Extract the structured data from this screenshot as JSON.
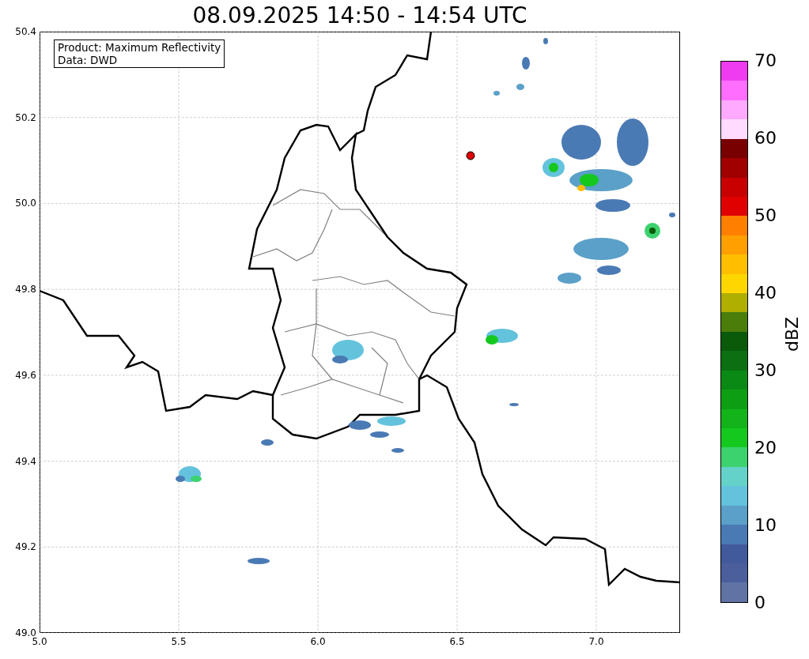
{
  "title": "08.09.2025 14:50 - 14:54 UTC",
  "legend": {
    "lines": [
      "Product: Maximum Reflectivity",
      "Data: DWD"
    ]
  },
  "map": {
    "x_ticks": [
      "5.0",
      "5.5",
      "6.0",
      "6.5",
      "7.0"
    ],
    "y_ticks": [
      "50.4",
      "50.2",
      "50.0",
      "49.8",
      "49.6",
      "49.4",
      "49.2",
      "49.0"
    ]
  },
  "colorbar": {
    "label": "dBZ",
    "ticks": [
      "70",
      "60",
      "50",
      "40",
      "30",
      "20",
      "10",
      "0"
    ],
    "segments": [
      {
        "color": "#f03cf0"
      },
      {
        "color": "#ff6eff"
      },
      {
        "color": "#ffaaff"
      },
      {
        "color": "#ffdcff"
      },
      {
        "color": "#780000"
      },
      {
        "color": "#a00000"
      },
      {
        "color": "#c80000"
      },
      {
        "color": "#e10000"
      },
      {
        "color": "#ff7f00"
      },
      {
        "color": "#ffa000"
      },
      {
        "color": "#ffbe00"
      },
      {
        "color": "#ffd700"
      },
      {
        "color": "#afaf00"
      },
      {
        "color": "#4b7d0a"
      },
      {
        "color": "#0a5a0a"
      },
      {
        "color": "#0c7012"
      },
      {
        "color": "#0a8a14"
      },
      {
        "color": "#0d9e14"
      },
      {
        "color": "#12b41a"
      },
      {
        "color": "#14c81e"
      },
      {
        "color": "#3cd26e"
      },
      {
        "color": "#64d2c8"
      },
      {
        "color": "#64c3dc"
      },
      {
        "color": "#5aa0c8"
      },
      {
        "color": "#4a7ab4"
      },
      {
        "color": "#415a9b"
      },
      {
        "color": "#4a5f9c"
      },
      {
        "color": "#5f73a5"
      }
    ]
  }
}
